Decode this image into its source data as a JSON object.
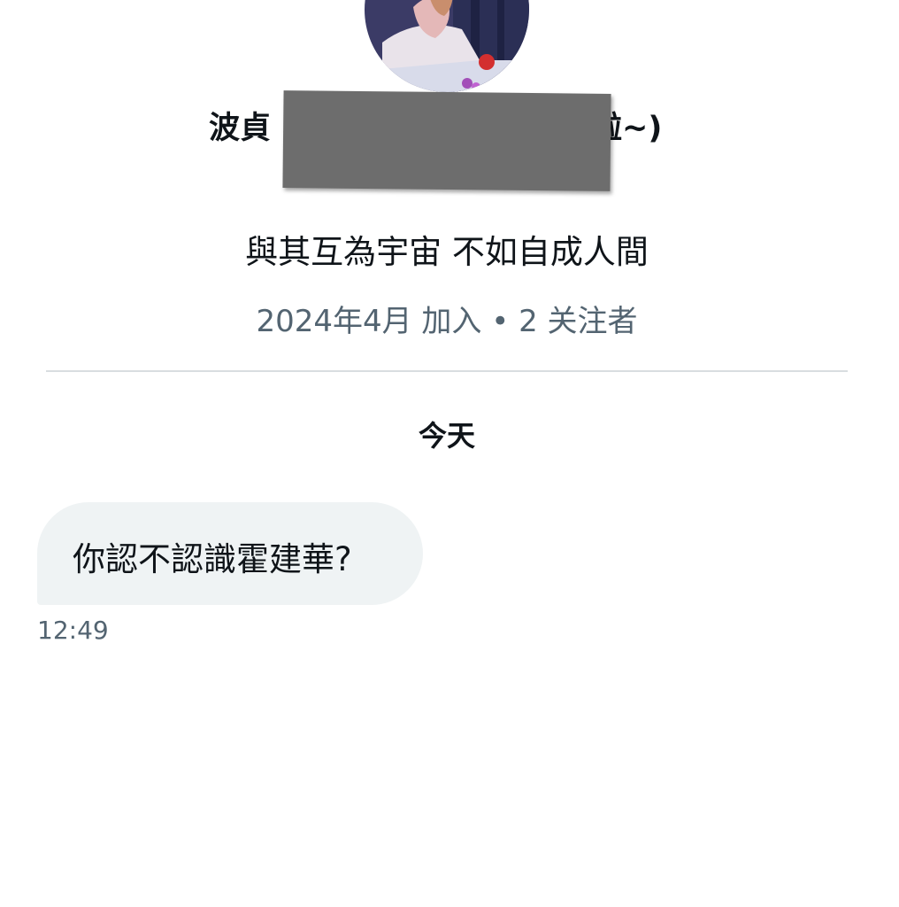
{
  "profile": {
    "display_name_visible_start": "波貞",
    "display_name_visible_end": "啦~)",
    "bio": "與其互為宇宙 不如自成人間",
    "joined": "2024年4月 加入",
    "separator": "•",
    "followers": "2 关注者"
  },
  "conversation": {
    "date_label": "今天",
    "messages": [
      {
        "text": "你認不認識霍建華?",
        "time": "12:49"
      }
    ]
  },
  "colors": {
    "bubble_bg": "#eff3f4",
    "secondary_text": "#536471",
    "primary_text": "#0f1419",
    "divider": "#d9dde0",
    "redaction": "#6d6d6d"
  },
  "icons": {
    "avatar": "profile-photo"
  }
}
